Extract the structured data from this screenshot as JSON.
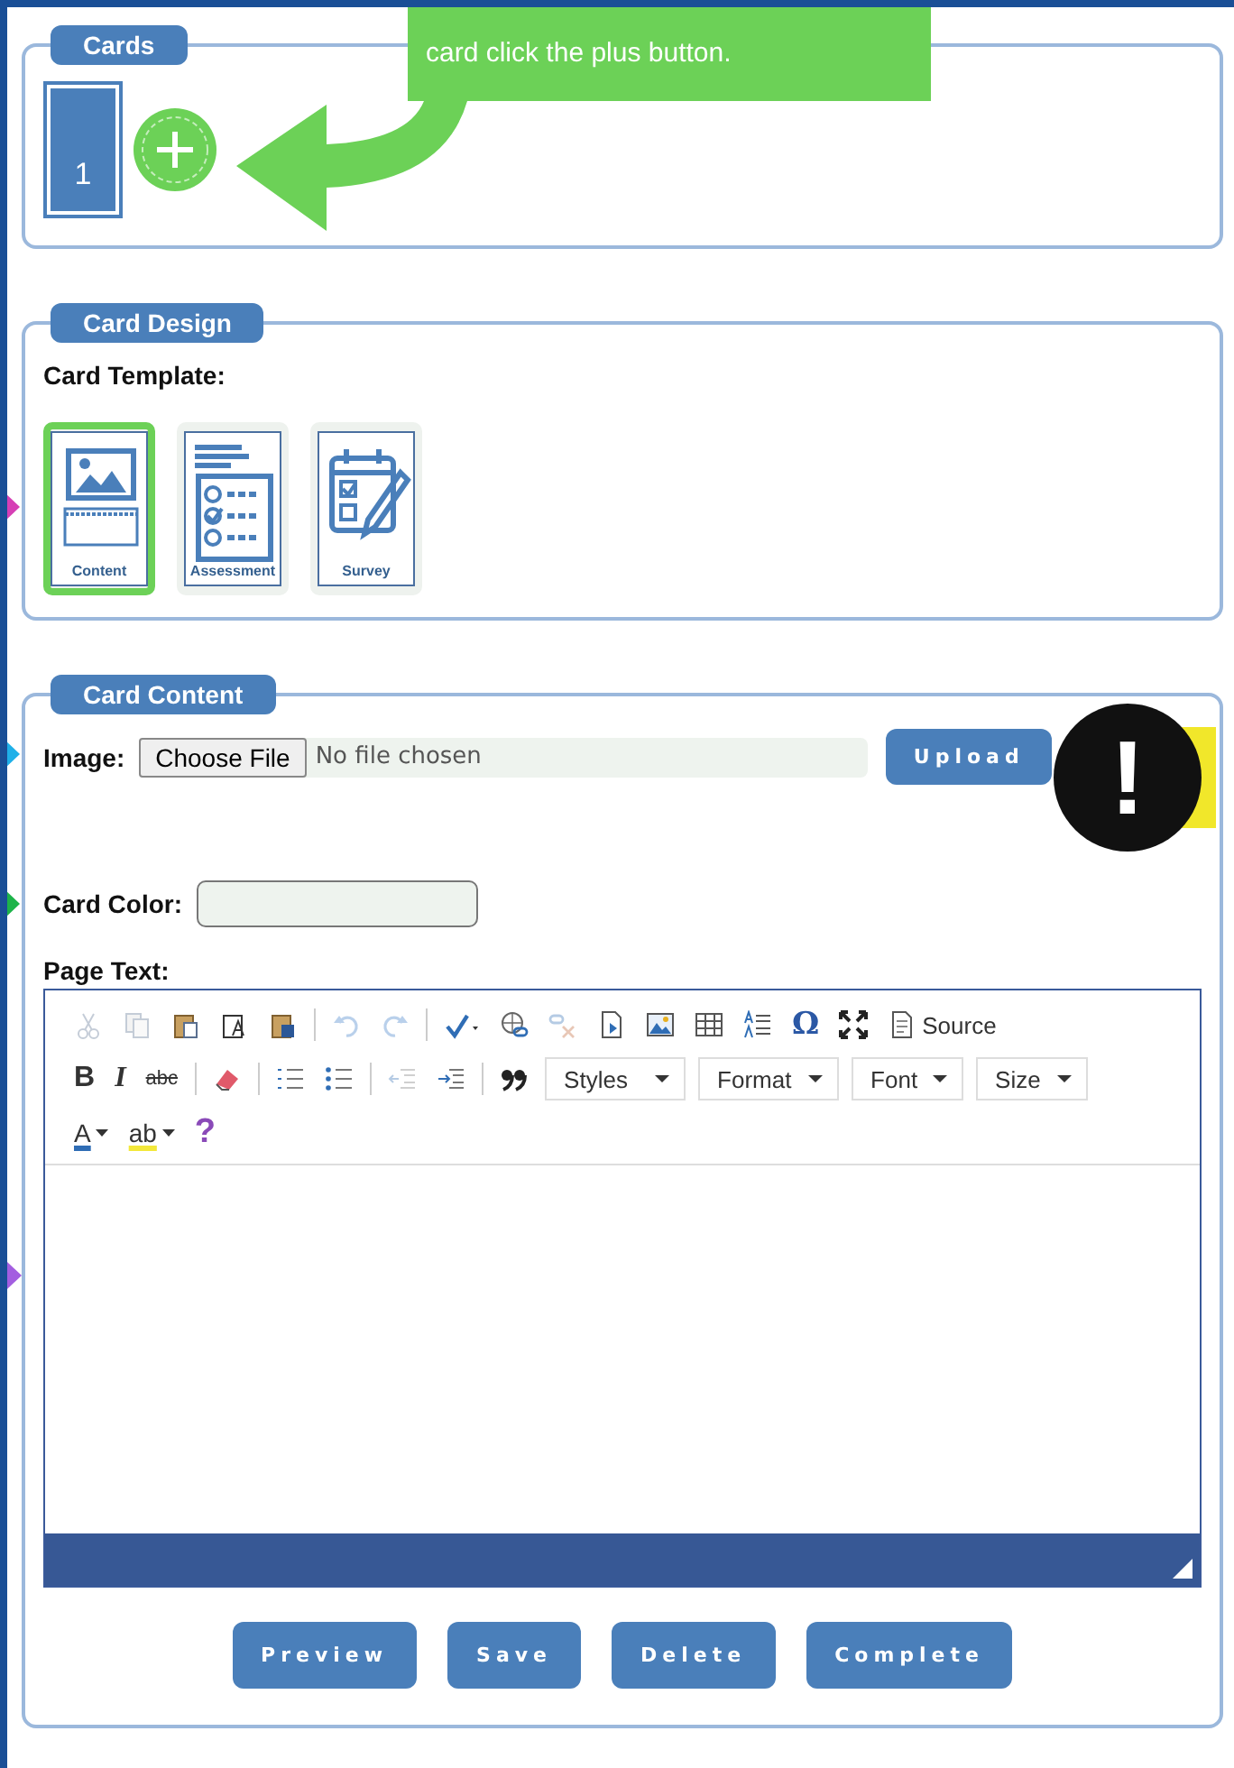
{
  "cards_panel": {
    "legend": "Cards",
    "cards": [
      {
        "label": "1"
      }
    ],
    "callout": "card click the plus button."
  },
  "design_panel": {
    "legend": "Card Design",
    "template_label": "Card Template:",
    "marker": {
      "color": "#d63fb5"
    },
    "templates": [
      {
        "kind": "content",
        "label": "Content",
        "selected": true
      },
      {
        "kind": "assessment",
        "label": "Assessment",
        "selected": false
      },
      {
        "kind": "survey",
        "label": "Survey",
        "selected": false
      }
    ]
  },
  "content_panel": {
    "legend": "Card Content",
    "image": {
      "label": "Image:",
      "choose_button": "Choose File",
      "file_status": "No file chosen",
      "upload_button": "Upload",
      "marker": {
        "color": "#1fb0e8"
      }
    },
    "alert": {
      "symbol": "!"
    },
    "card_color": {
      "label": "Card Color:",
      "marker": {
        "color": "#1db34a"
      }
    },
    "page_text": {
      "label": "Page Text:",
      "marker": {
        "color": "#a35ee0"
      }
    },
    "toolbar": [
      {
        "items": [
          {
            "kind": "cut",
            "disabled": true
          },
          {
            "kind": "copy",
            "disabled": true
          },
          {
            "kind": "paste",
            "disabled": false
          },
          {
            "kind": "paste-text",
            "disabled": false
          },
          {
            "kind": "paste-word",
            "disabled": false
          },
          {
            "kind": "sep"
          },
          {
            "kind": "undo",
            "disabled": true
          },
          {
            "kind": "redo",
            "disabled": true
          },
          {
            "kind": "sep"
          },
          {
            "kind": "spellcheck",
            "disabled": false
          },
          {
            "kind": "link",
            "disabled": false
          },
          {
            "kind": "unlink",
            "disabled": true
          },
          {
            "kind": "page",
            "disabled": false
          },
          {
            "kind": "image",
            "disabled": false
          },
          {
            "kind": "table",
            "disabled": false
          },
          {
            "kind": "lines",
            "disabled": false
          },
          {
            "kind": "glyph",
            "text": "Ω",
            "disabled": false
          },
          {
            "kind": "maximize",
            "disabled": false
          },
          {
            "kind": "source",
            "text": "Source",
            "disabled": false
          }
        ]
      },
      {
        "items": [
          {
            "kind": "bold",
            "text": "B",
            "disabled": false
          },
          {
            "kind": "italic",
            "text": "I",
            "disabled": false
          },
          {
            "kind": "strike",
            "text": "abc",
            "disabled": false
          },
          {
            "kind": "sep"
          },
          {
            "kind": "eraser",
            "disabled": false
          },
          {
            "kind": "sep"
          },
          {
            "kind": "numbered",
            "disabled": false
          },
          {
            "kind": "bulleted",
            "disabled": false
          },
          {
            "kind": "sep"
          },
          {
            "kind": "outdent",
            "disabled": true
          },
          {
            "kind": "indent",
            "disabled": false
          },
          {
            "kind": "sep"
          },
          {
            "kind": "quote",
            "disabled": false
          },
          {
            "kind": "combo",
            "text": "Styles"
          },
          {
            "kind": "combo",
            "text": "Format"
          },
          {
            "kind": "combo",
            "text": "Font"
          },
          {
            "kind": "combo",
            "text": "Size"
          }
        ]
      },
      {
        "items": [
          {
            "kind": "text-color",
            "text": "A",
            "disabled": false
          },
          {
            "kind": "bg-color",
            "text": "ab",
            "disabled": false
          },
          {
            "kind": "help",
            "text": "?",
            "disabled": false
          }
        ]
      }
    ],
    "buttons": [
      "Preview",
      "Save",
      "Delete",
      "Complete"
    ]
  }
}
